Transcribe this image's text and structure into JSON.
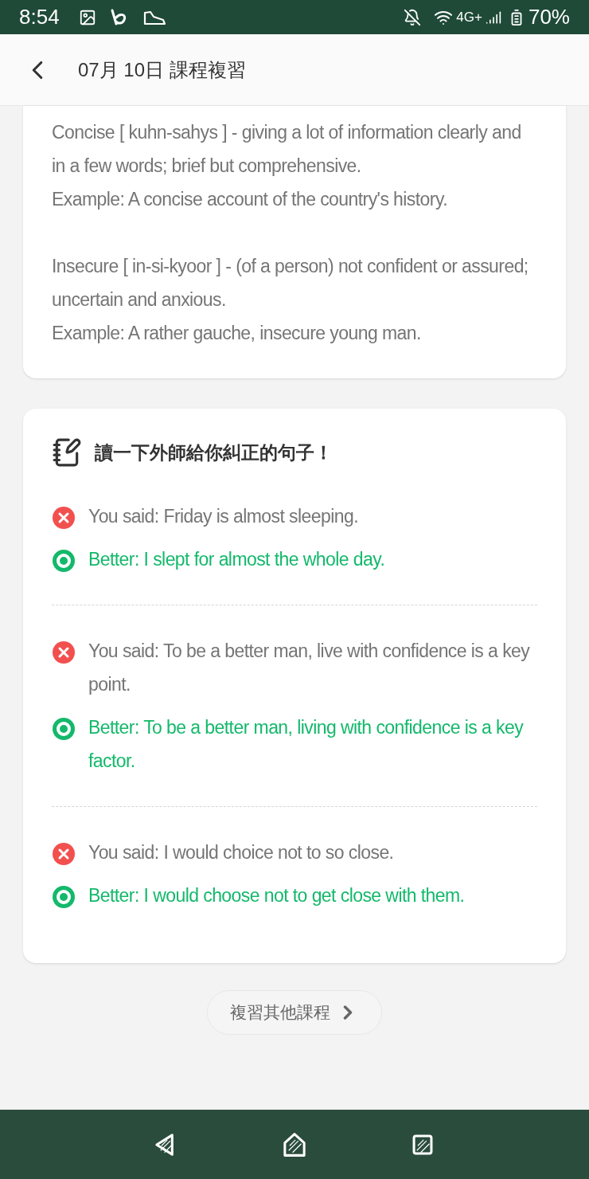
{
  "status_bar": {
    "time": "8:54",
    "network": "4G+",
    "battery": "70%"
  },
  "header": {
    "title": "07月 10日 課程複習"
  },
  "vocabulary": [
    {
      "definition": "Concise [ kuhn-sahys ] - giving a lot of information clearly and in a few words; brief but comprehensive.",
      "example": "Example: A concise account of the country's history."
    },
    {
      "definition": "Insecure [ in-si-kyoor ] - (of a person) not confident or assured; uncertain and anxious.",
      "example": "Example: A rather gauche, insecure young man."
    }
  ],
  "corrections": {
    "title": "讀一下外師給你糾正的句子！",
    "items": [
      {
        "said": "You said: Friday is almost sleeping.",
        "better": "Better: I slept for almost the whole day."
      },
      {
        "said": "You said: To be a better man, live with confidence is a key point.",
        "better": "Better: To be a better man, living with confidence is a key factor."
      },
      {
        "said": "You said: I would choice not to so close.",
        "better": "Better: I would choose not to get close with them."
      }
    ]
  },
  "more_button": {
    "label": "複習其他課程"
  }
}
